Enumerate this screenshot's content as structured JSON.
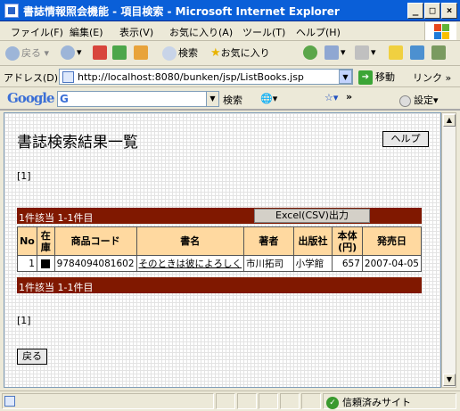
{
  "window": {
    "title": "書誌情報照会機能 - 項目検索 - Microsoft Internet Explorer"
  },
  "menu": [
    "ファイル(F)",
    "編集(E)",
    "表示(V)",
    "お気に入り(A)",
    "ツール(T)",
    "ヘルプ(H)"
  ],
  "toolbar": {
    "back": "戻る",
    "search": "検索",
    "favorites": "お気に入り"
  },
  "address": {
    "label": "アドレス(D)",
    "url": "http://localhost:8080/bunken/jsp/ListBooks.jsp",
    "go": "移動",
    "links": "リンク"
  },
  "google": {
    "logo": "Google",
    "input_prefix": "G",
    "search": "検索",
    "settings": "設定"
  },
  "page": {
    "title": "書誌検索結果一覧",
    "help_button": "ヘルプ",
    "pager_top": "[1]",
    "pager_bottom": "[1]",
    "summary": "1件該当  1-1件目",
    "csv_button": "Excel(CSV)出力",
    "back_button": "戻る"
  },
  "table": {
    "headers": [
      "No",
      "在庫",
      "商品コード",
      "書名",
      "著者",
      "出版社",
      "本体(円)",
      "発売日"
    ],
    "rows": [
      {
        "no": "1",
        "code": "9784094081602",
        "title": "そのときは彼によろしく",
        "author": "市川拓司",
        "publisher": "小学館",
        "price": "657",
        "date": "2007-04-05"
      }
    ]
  },
  "status": {
    "trust": "信頼済みサイト"
  },
  "colors": {
    "summary_bar": "#801800",
    "header_bg": "#ffd9a0",
    "titlebar": "#0a5fd8"
  }
}
